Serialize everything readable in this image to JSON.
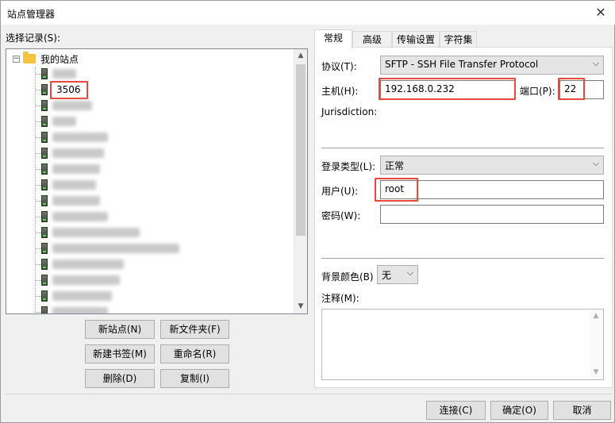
{
  "window": {
    "title": "站点管理器",
    "close_icon": "close-icon"
  },
  "left": {
    "select_label": "选择记录(S):",
    "tree": {
      "root_label": "我的站点",
      "expander": "−",
      "items": [
        {
          "label": ""
        },
        {
          "label": "3506"
        },
        {
          "label": ""
        },
        {
          "label": ""
        },
        {
          "label": ""
        },
        {
          "label": ""
        },
        {
          "label": ""
        },
        {
          "label": ""
        },
        {
          "label": ""
        },
        {
          "label": ""
        },
        {
          "label": ""
        },
        {
          "label": ""
        },
        {
          "label": ""
        },
        {
          "label": ""
        },
        {
          "label": ""
        },
        {
          "label": ""
        },
        {
          "label": ""
        }
      ]
    },
    "buttons": {
      "new_site": "新站点(N)",
      "new_folder": "新文件夹(F)",
      "new_bookmark": "新建书签(M)",
      "rename": "重命名(R)",
      "delete": "删除(D)",
      "copy": "复制(I)"
    }
  },
  "tabs": [
    "常规",
    "高级",
    "传输设置",
    "字符集"
  ],
  "general": {
    "protocol_label": "协议(T):",
    "protocol_value": "SFTP - SSH File Transfer Protocol",
    "host_label": "主机(H):",
    "host_value": "192.168.0.232",
    "port_label": "端口(P):",
    "port_value": "22",
    "jurisdiction_label": "Jurisdiction:",
    "logon_type_label": "登录类型(L):",
    "logon_type_value": "正常",
    "user_label": "用户(U):",
    "user_value": "root",
    "password_label": "密码(W):",
    "password_value": "",
    "bg_color_label": "背景颜色(B)",
    "bg_color_value": "无",
    "comments_label": "注释(M):"
  },
  "footer": {
    "connect": "连接(C)",
    "ok": "确定(O)",
    "cancel": "取消"
  },
  "colors": {
    "highlight": "#e8473a",
    "folder": "#f5c342"
  }
}
